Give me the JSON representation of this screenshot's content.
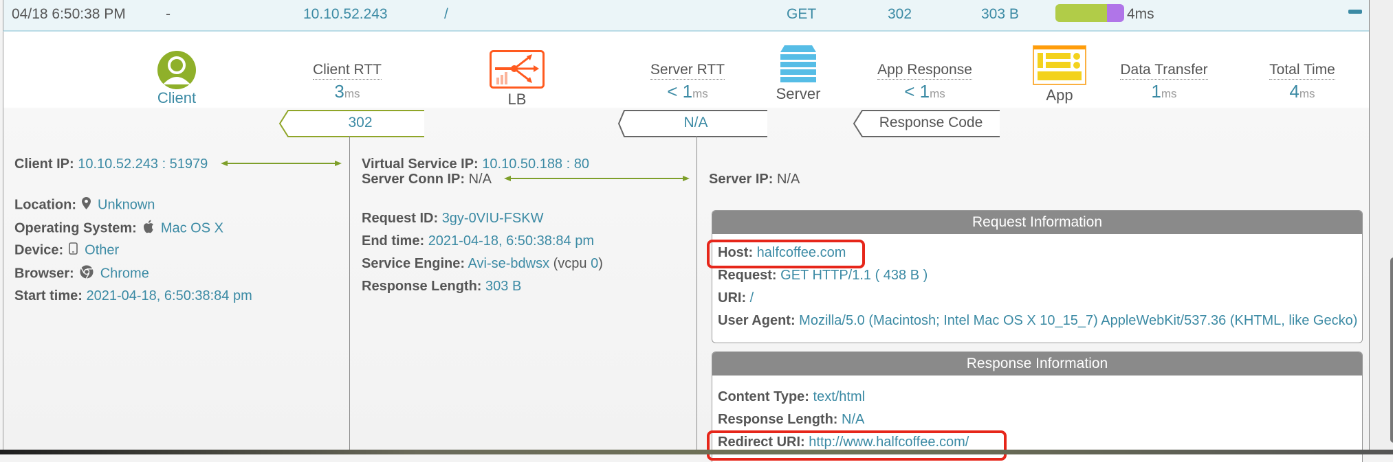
{
  "log_row": {
    "timestamp": "04/18 6:50:38 PM",
    "dash": "-",
    "client_ip": "10.10.52.243",
    "uri": "/",
    "method": "GET",
    "status": "302",
    "size": "303 B",
    "timing_bar": {
      "client_rtt_fraction": 0.75,
      "data_transfer_fraction": 0.25,
      "colors": {
        "primary": "#b1cc48",
        "secondary": "#b075e8"
      }
    },
    "total": "4ms",
    "collapse_icon": "minus-icon"
  },
  "flow": {
    "nodes": {
      "client": {
        "label": "Client",
        "icon": "user-circle-icon"
      },
      "lb": {
        "label": "LB",
        "icon": "load-balancer-icon"
      },
      "server": {
        "label": "Server",
        "icon": "server-stack-icon"
      },
      "app": {
        "label": "App",
        "icon": "app-window-icon"
      }
    },
    "metrics": [
      {
        "title": "Client RTT",
        "prefix": "",
        "value": "3",
        "unit": "ms"
      },
      {
        "title": "Server RTT",
        "prefix": "< ",
        "value": "1",
        "unit": "ms"
      },
      {
        "title": "App Response",
        "prefix": "< ",
        "value": "1",
        "unit": "ms"
      },
      {
        "title": "Data Transfer",
        "prefix": "",
        "value": "1",
        "unit": "ms"
      },
      {
        "title": "Total Time",
        "prefix": "",
        "value": "4",
        "unit": "ms"
      }
    ],
    "tags": [
      {
        "text": "302"
      },
      {
        "text": "N/A"
      },
      {
        "text": "Response Code"
      }
    ]
  },
  "client_col": {
    "client_ip_label": "Client IP:",
    "client_ip": "10.10.52.243 : 51979",
    "location_label": "Location:",
    "location": "Unknown",
    "os_label": "Operating System:",
    "os": "Mac OS X",
    "device_label": "Device:",
    "device": "Other",
    "browser_label": "Browser:",
    "browser": "Chrome",
    "start_label": "Start time:",
    "start": "2021-04-18, 6:50:38:84 pm"
  },
  "lb_col": {
    "vs_ip_label": "Virtual Service IP:",
    "vs_ip": "10.10.50.188 : 80",
    "conn_ip_label": "Server Conn IP:",
    "conn_ip": "N/A",
    "req_id_label": "Request ID:",
    "req_id": "3gy-0VIU-FSKW",
    "end_label": "End time:",
    "end": "2021-04-18, 6:50:38:84 pm",
    "se_label": "Service Engine:",
    "se": "Avi-se-bdwsx",
    "se_vcpu_prefix": "(vcpu ",
    "se_vcpu": "0",
    "se_vcpu_suffix": ")",
    "resp_len_label": "Response Length:",
    "resp_len": "303 B"
  },
  "server_col": {
    "server_ip_label": "Server IP:",
    "server_ip": "N/A",
    "request_info": {
      "title": "Request Information",
      "host_label": "Host:",
      "host": "halfcoffee.com",
      "request_label": "Request:",
      "request": "GET HTTP/1.1 ( 438 B )",
      "uri_label": "URI:",
      "uri": "/",
      "ua_label": "User Agent:",
      "ua": "Mozilla/5.0 (Macintosh; Intel Mac OS X 10_15_7) AppleWebKit/537.36 (KHTML, like Gecko)"
    },
    "response_info": {
      "title": "Response Information",
      "ctype_label": "Content Type:",
      "ctype": "text/html",
      "len_label": "Response Length:",
      "len": "N/A",
      "redirect_label": "Redirect URI:",
      "redirect": "http://www.halfcoffee.com/"
    }
  },
  "colors": {
    "accent": "#3b8aa4",
    "arrow_green": "#7e9f2a",
    "highlight_red": "#e6261a",
    "lb_orange": "#ff5a1f",
    "server_blue": "#56bde6",
    "app_yellow": "#f3d21d"
  }
}
